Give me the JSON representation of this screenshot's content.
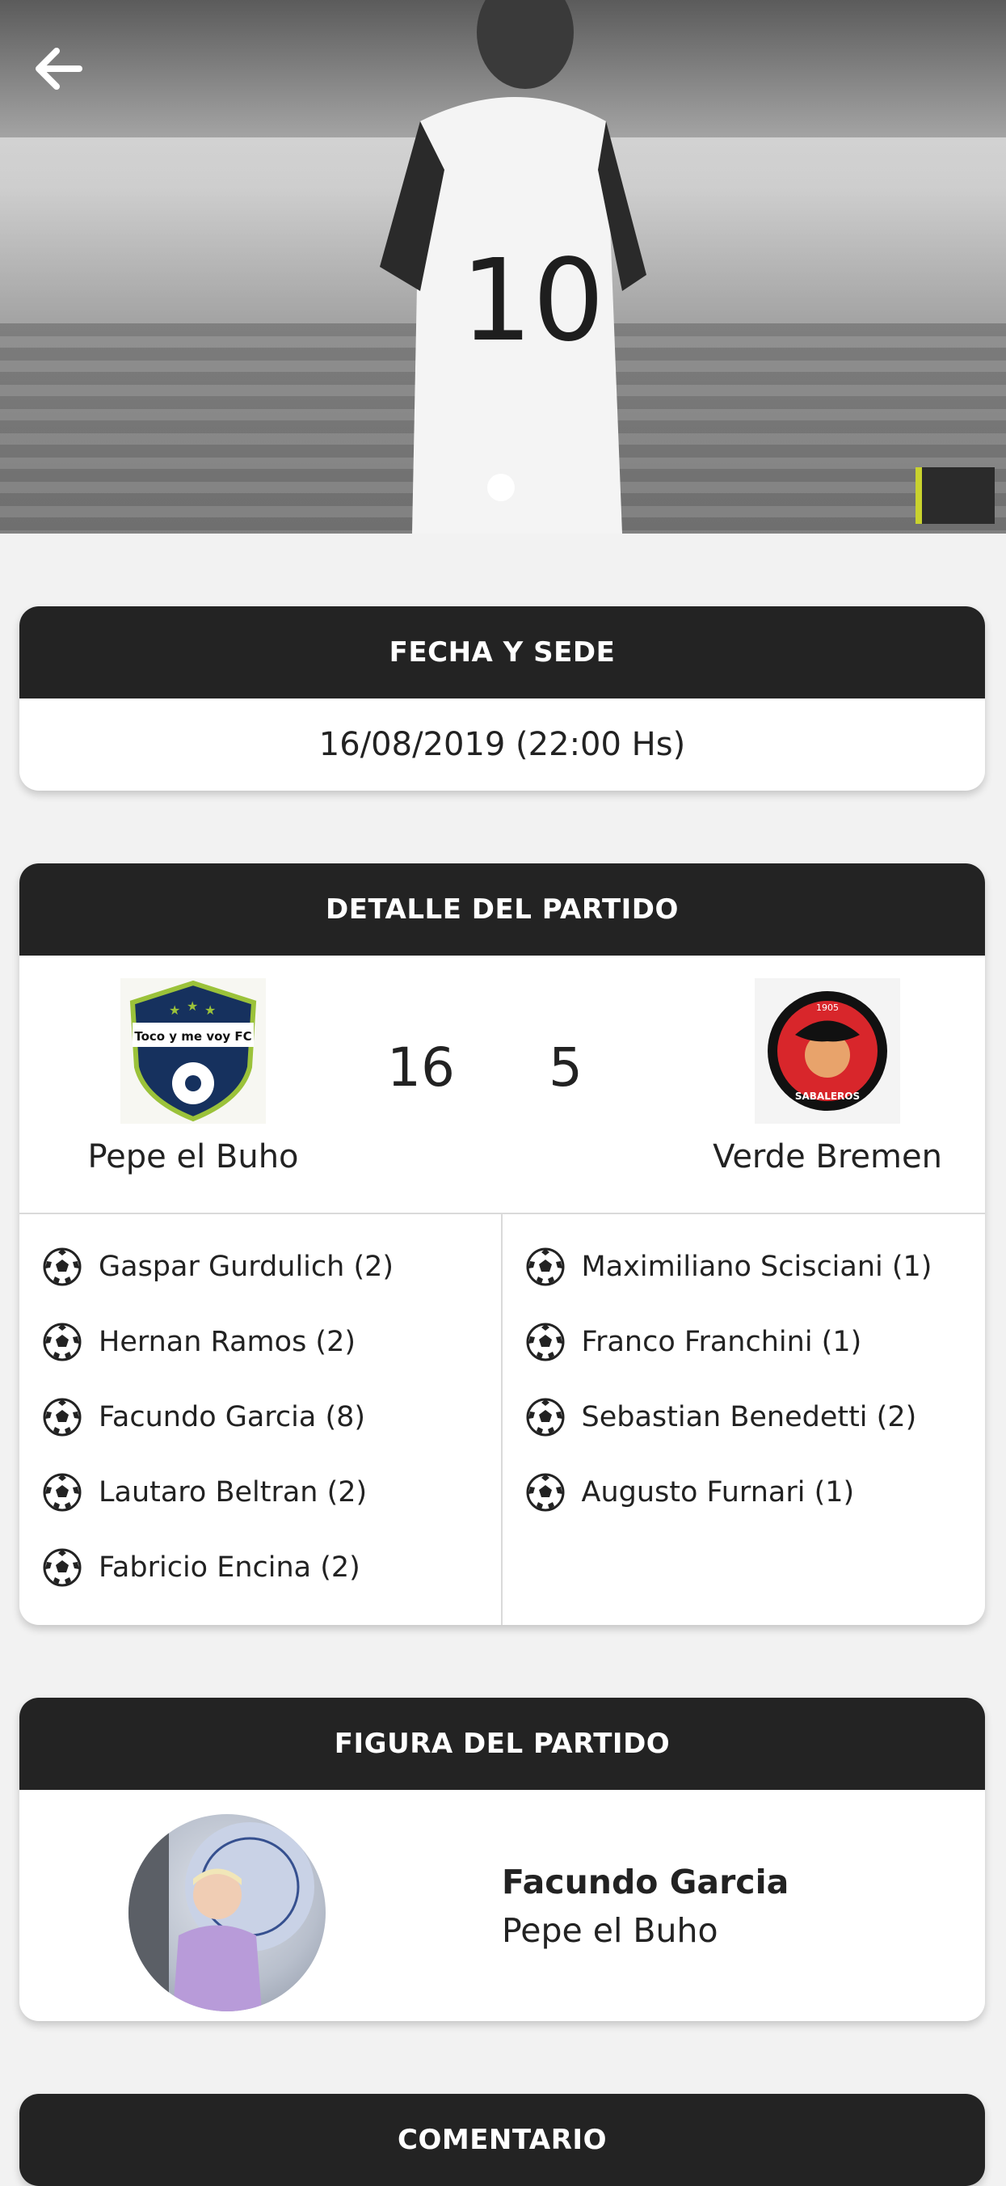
{
  "header": {
    "back_icon": "arrow-left-icon"
  },
  "colors": {
    "card_header_bg": "#232323",
    "card_header_text": "#ffffff",
    "page_bg": "#f2f2f2"
  },
  "fecha_card": {
    "title": "FECHA Y SEDE",
    "datetime": "16/08/2019 (22:00 Hs)"
  },
  "match_card": {
    "title": "DETALLE DEL PARTIDO",
    "home": {
      "name": "Pepe el Buho",
      "score": "16",
      "crest_text": "Toco y me voy FC",
      "scorers": [
        "Gaspar Gurdulich (2)",
        "Hernan Ramos (2)",
        "Facundo Garcia (8)",
        "Lautaro Beltran (2)",
        "Fabricio Encina (2)"
      ]
    },
    "away": {
      "name": "Verde Bremen",
      "score": "5",
      "crest_text": "SABALEROS",
      "crest_year": "1905",
      "scorers": [
        "Maximiliano Scisciani (1)",
        "Franco Franchini (1)",
        "Sebastian Benedetti (2)",
        "Augusto Furnari (1)"
      ]
    }
  },
  "figure_card": {
    "title": "FIGURA DEL PARTIDO",
    "player_name": "Facundo Garcia",
    "player_team": "Pepe el Buho"
  },
  "comment_card": {
    "title": "COMENTARIO"
  }
}
